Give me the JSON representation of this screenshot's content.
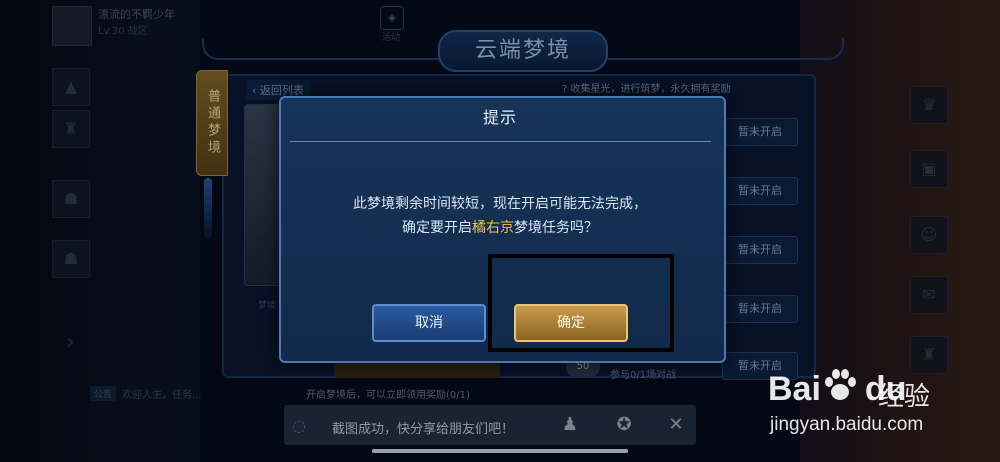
{
  "background": {
    "top_username": "漂流的不羁少年",
    "top_sub": "Lv.30  战区",
    "top_icon_label": "活动",
    "left_bottom_badge": "公告",
    "left_bottom_text": "欢迎人生，任务...",
    "thumb_label": "梦境"
  },
  "panel": {
    "title": "云端梦境",
    "side_tab": "普通梦境",
    "back_label": "返回列表",
    "help_text": "? 收集星光，进行筑梦，永久拥有奖励",
    "status_buttons": [
      "暂未开启",
      "暂未开启",
      "暂未开启",
      "暂未开启",
      "暂未开启"
    ],
    "bottom_task_text": "开启梦境后，可以立即领用奖励(0/1)",
    "progress_badge": "50",
    "bottom_progress": "参与0/1场对战"
  },
  "modal": {
    "title": "提示",
    "line1": "此梦境剩余时间较短，现在开启可能无法完成，",
    "line2_pre": "确定要开启",
    "line2_highlight": "橘右京",
    "line2_post": "梦境任务吗？",
    "cancel_label": "取消",
    "confirm_label": "确定"
  },
  "screenshot_bar": {
    "text": "截图成功，快分享给朋友们吧！",
    "close_glyph": "✕"
  },
  "watermark": {
    "brand": "Bai",
    "brand2": "du",
    "cn": "经验",
    "url": "jingyan.baidu.com"
  },
  "colors": {
    "accent_gold": "#f4c24a",
    "confirm_bg": "#b08238",
    "cancel_bg": "#2a5aa0"
  }
}
